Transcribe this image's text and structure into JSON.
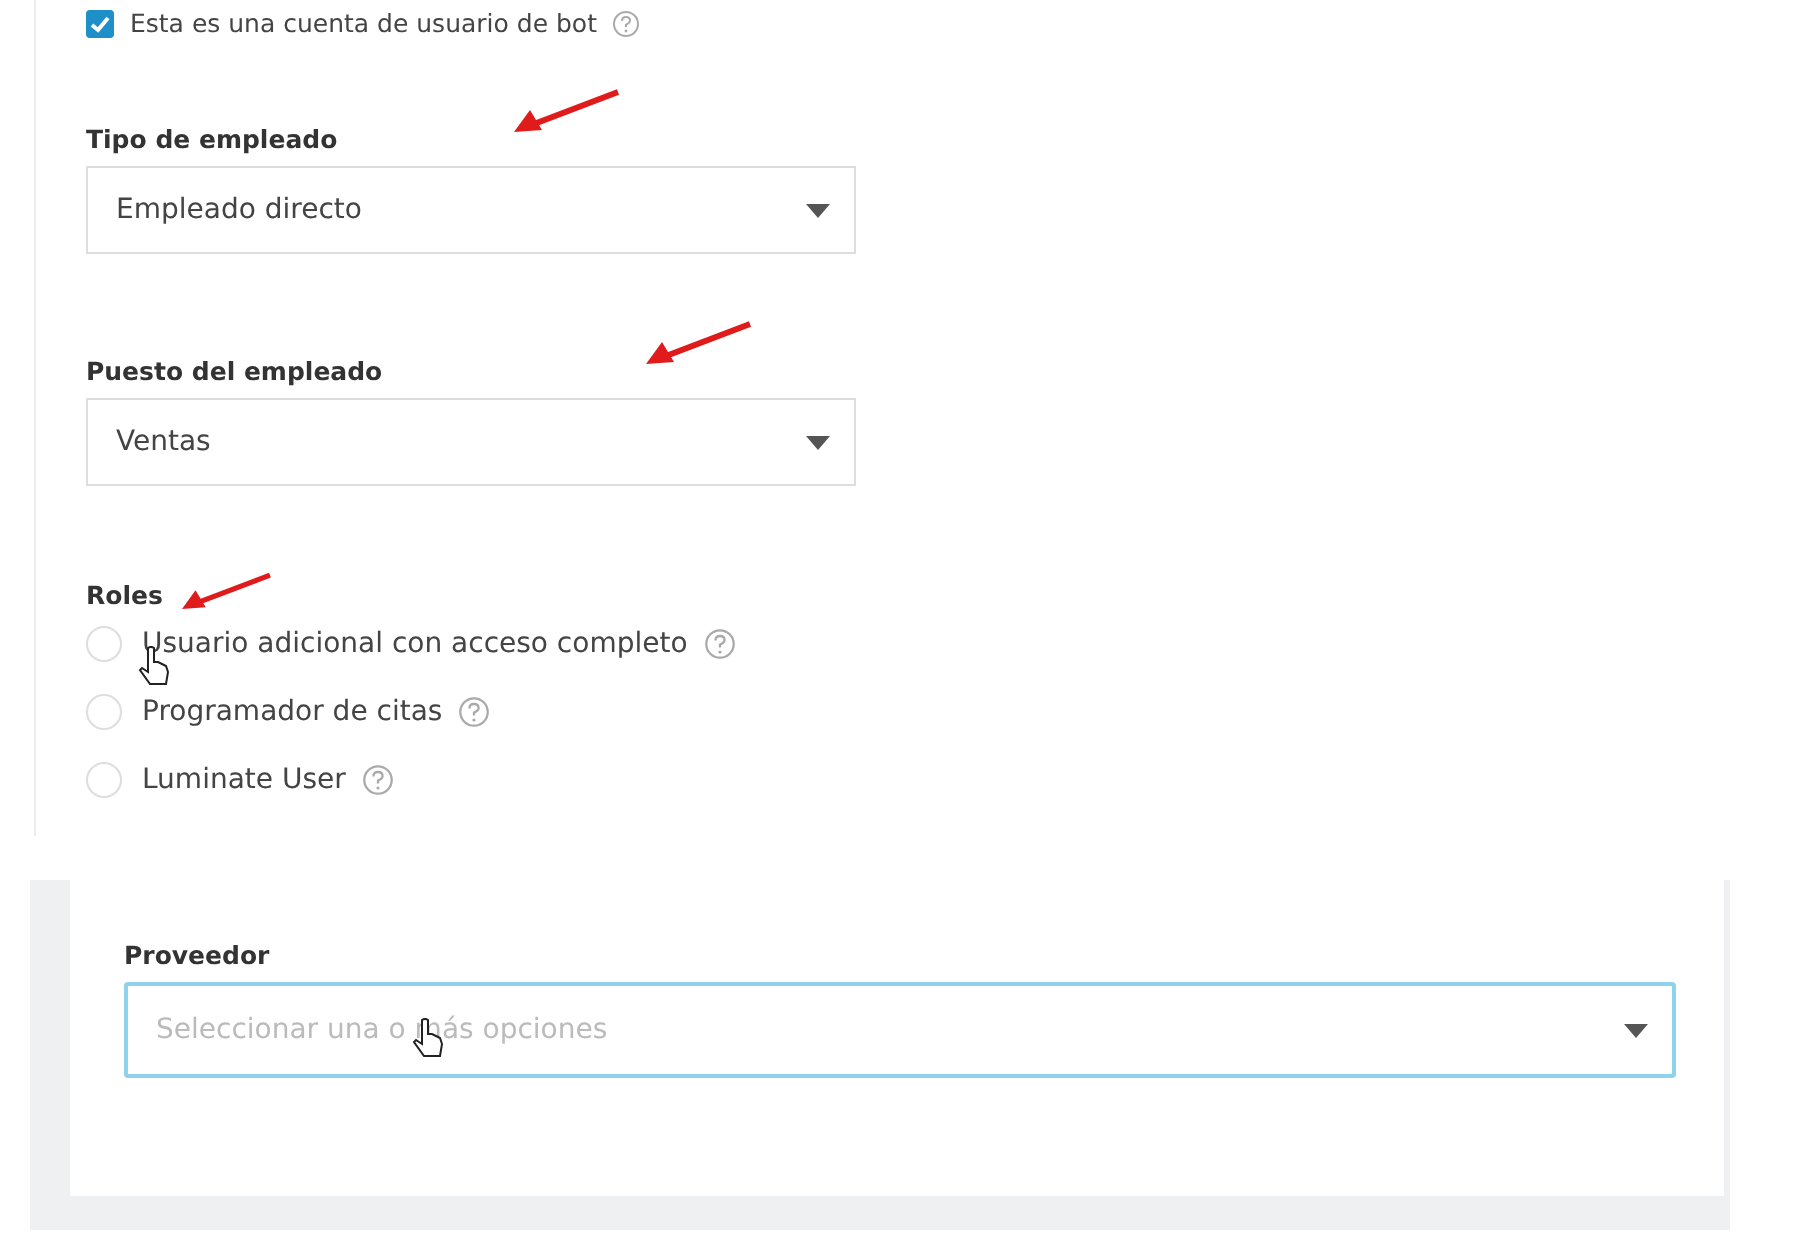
{
  "bot_account": {
    "label": "Esta es una cuenta de usuario de bot",
    "checked": true
  },
  "fields": [
    {
      "label": "Tipo de empleado",
      "value": "Empleado directo"
    },
    {
      "label": "Puesto del empleado",
      "value": "Ventas"
    }
  ],
  "roles": {
    "label": "Roles",
    "options": [
      {
        "label": "Usuario adicional con acceso completo",
        "selected": false
      },
      {
        "label": "Programador de citas",
        "selected": false
      },
      {
        "label": "Luminate User",
        "selected": false
      }
    ]
  },
  "provider": {
    "label": "Proveedor",
    "placeholder": "Seleccionar una o más opciones"
  }
}
